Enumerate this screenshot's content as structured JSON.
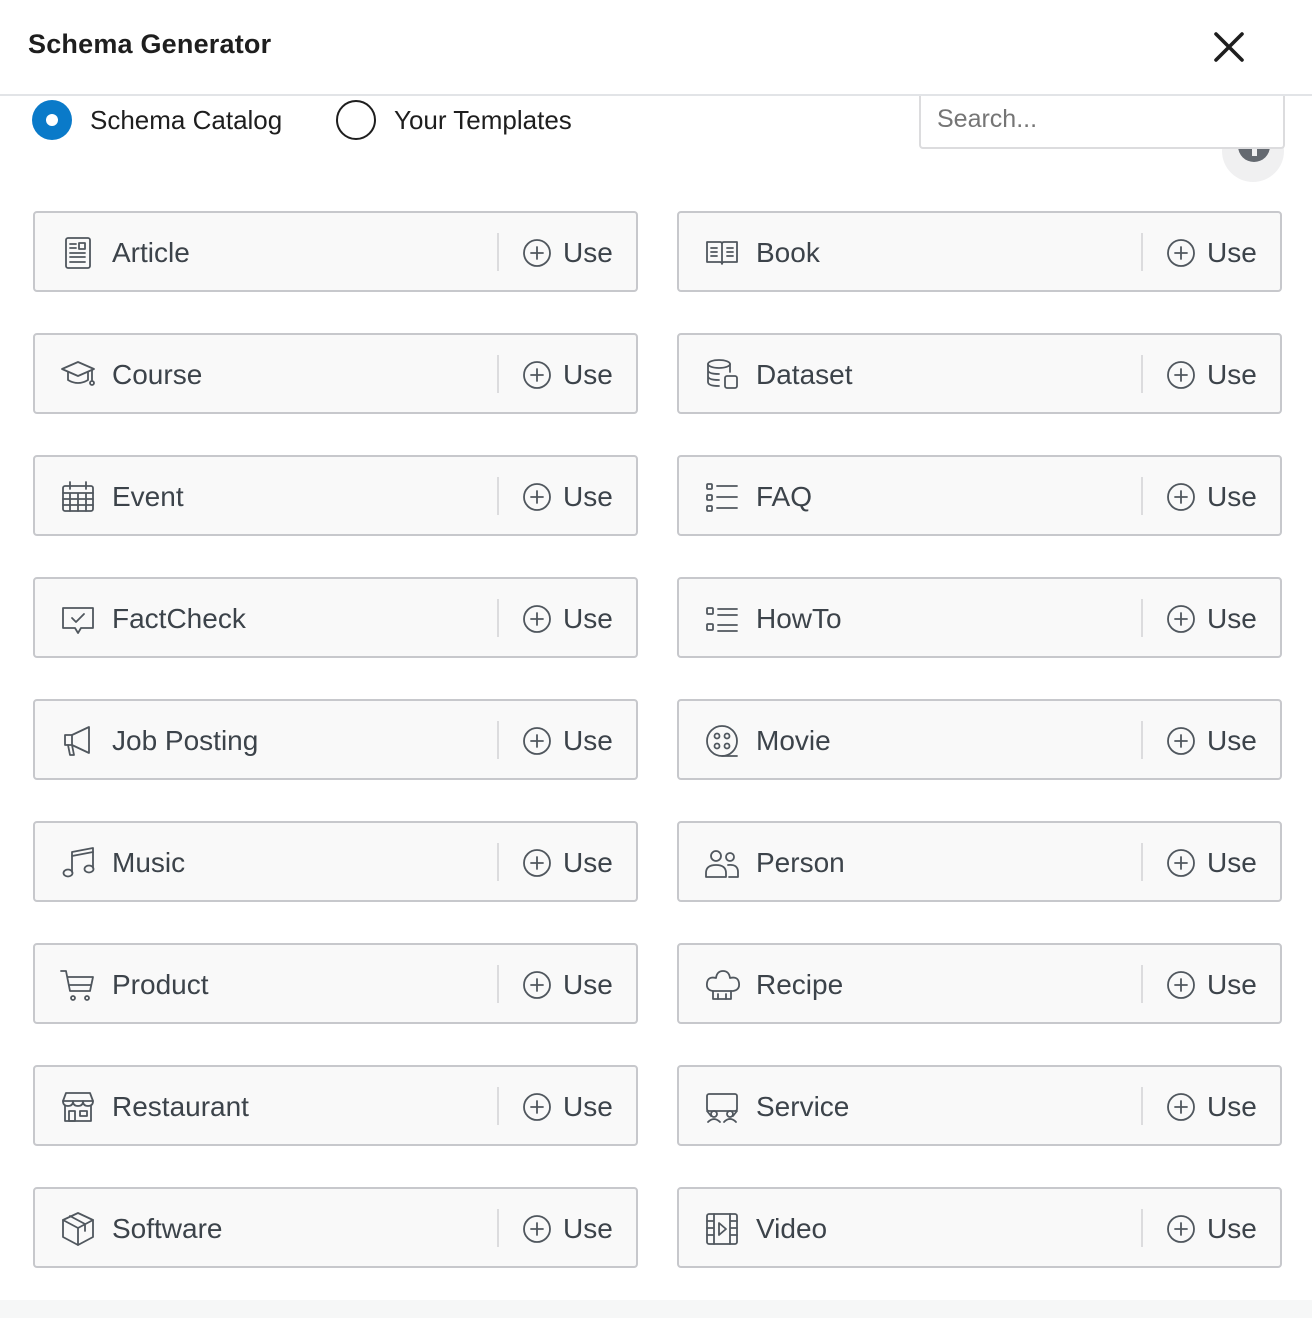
{
  "dialog": {
    "title": "Schema Generator",
    "close_icon": "close-icon"
  },
  "tabs": {
    "catalog_label": "Schema Catalog",
    "templates_label": "Your Templates",
    "selected": "catalog"
  },
  "search": {
    "placeholder": "Search...",
    "value": ""
  },
  "colors": {
    "accent": "#0a7ac9",
    "card_border": "#c7c8cc",
    "card_bg": "#f9f9f9",
    "text": "#3c434a"
  },
  "schemas": [
    {
      "name": "Article",
      "icon": "article-icon",
      "action": "Use"
    },
    {
      "name": "Book",
      "icon": "book-icon",
      "action": "Use"
    },
    {
      "name": "Course",
      "icon": "graduation-cap-icon",
      "action": "Use"
    },
    {
      "name": "Dataset",
      "icon": "database-icon",
      "action": "Use"
    },
    {
      "name": "Event",
      "icon": "calendar-icon",
      "action": "Use"
    },
    {
      "name": "FAQ",
      "icon": "list-icon",
      "action": "Use"
    },
    {
      "name": "FactCheck",
      "icon": "check-comment-icon",
      "action": "Use"
    },
    {
      "name": "HowTo",
      "icon": "steps-list-icon",
      "action": "Use"
    },
    {
      "name": "Job Posting",
      "icon": "megaphone-icon",
      "action": "Use"
    },
    {
      "name": "Movie",
      "icon": "film-reel-icon",
      "action": "Use"
    },
    {
      "name": "Music",
      "icon": "music-note-icon",
      "action": "Use"
    },
    {
      "name": "Person",
      "icon": "people-icon",
      "action": "Use"
    },
    {
      "name": "Product",
      "icon": "cart-icon",
      "action": "Use"
    },
    {
      "name": "Recipe",
      "icon": "chef-hat-icon",
      "action": "Use"
    },
    {
      "name": "Restaurant",
      "icon": "storefront-icon",
      "action": "Use"
    },
    {
      "name": "Service",
      "icon": "service-desk-icon",
      "action": "Use"
    },
    {
      "name": "Software",
      "icon": "box-icon",
      "action": "Use"
    },
    {
      "name": "Video",
      "icon": "video-icon",
      "action": "Use"
    }
  ]
}
